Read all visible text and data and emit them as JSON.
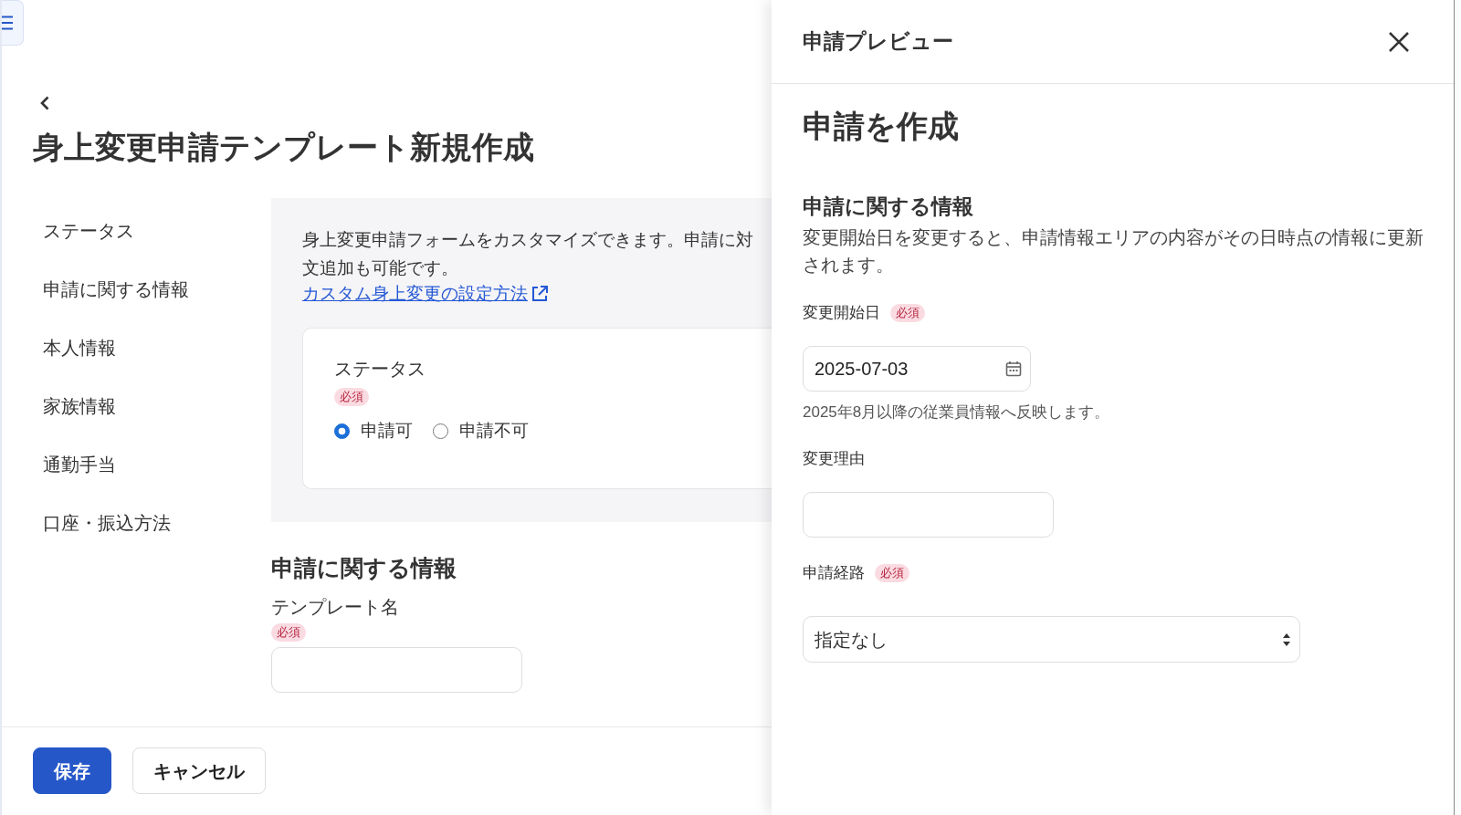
{
  "page": {
    "title": "身上変更申請テンプレート新規作成"
  },
  "sidebar": {
    "items": [
      {
        "label": "ステータス"
      },
      {
        "label": "申請に関する情報"
      },
      {
        "label": "本人情報"
      },
      {
        "label": "家族情報"
      },
      {
        "label": "通勤手当"
      },
      {
        "label": "口座・振込方法"
      }
    ]
  },
  "intro": {
    "lines": [
      "身上変更申請フォームをカスタマイズできます。申請に対",
      "文追加も可能です。"
    ],
    "link": {
      "label": "カスタム身上変更の設定方法"
    }
  },
  "status_card": {
    "label": "ステータス",
    "badge": "必須",
    "options": [
      {
        "label": "申請可",
        "selected": true
      },
      {
        "label": "申請不可",
        "selected": false
      }
    ]
  },
  "section": {
    "heading": "申請に関する情報",
    "fields": [
      {
        "kind": "text",
        "label": "テンプレート名",
        "badge": "必須"
      }
    ]
  },
  "footer": {
    "buttons": [
      {
        "label": "保存",
        "kind": "primary"
      },
      {
        "label": "キャンセル",
        "kind": "secondary"
      }
    ]
  },
  "drawer": {
    "title": "申請プレビュー",
    "heading": "申請を作成",
    "section_title": "申請に関する情報",
    "description": "変更開始日を変更すると、申請情報エリアの内容がその日時点の情報に更新されます。",
    "fields": [
      {
        "kind": "date",
        "label": "変更開始日",
        "badge": "必須",
        "value": "2025-07-03",
        "help": "2025年8月以降の従業員情報へ反映します。"
      },
      {
        "kind": "text",
        "label": "変更理由"
      },
      {
        "kind": "select",
        "label": "申請経路",
        "badge": "必須",
        "value": "指定なし"
      }
    ]
  }
}
